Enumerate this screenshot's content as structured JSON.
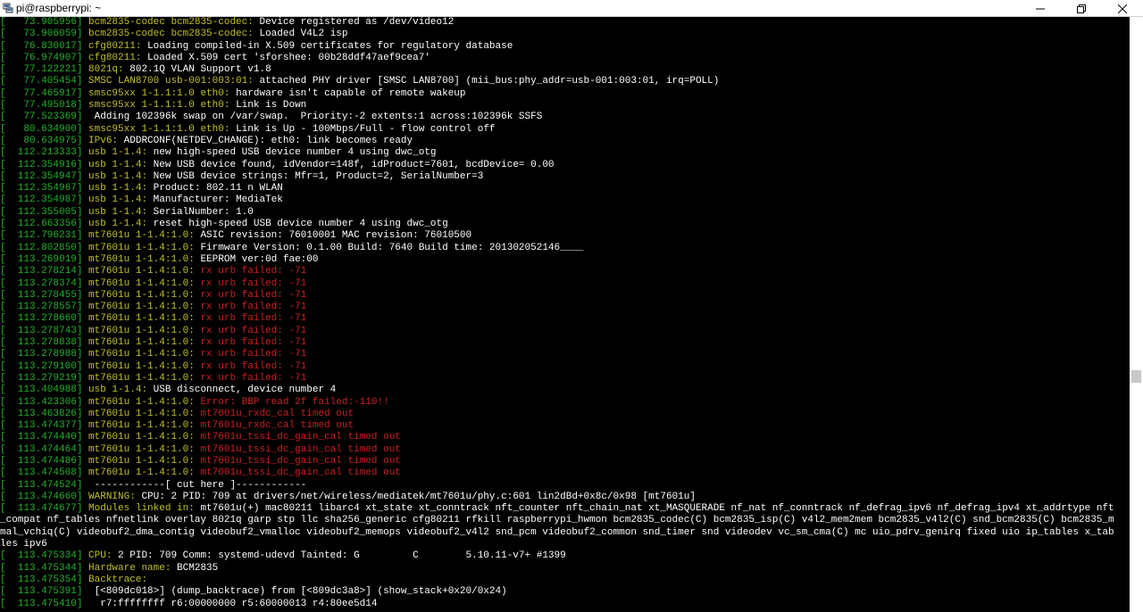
{
  "window": {
    "title": "pi@raspberrypi: ~",
    "minimize_glyph": "—",
    "maximize_glyph": "❐",
    "close_glyph": "✕"
  },
  "colors": {
    "background": "#000000",
    "text": "#ffffff",
    "timestamp": "#22b22a",
    "subsystem": "#c0c02a",
    "error": "#cc1f1f"
  },
  "lines": [
    {
      "ts": "[   73.905956]",
      "sub": "bcm2835-codec bcm2835-codec:",
      "msg": " Device registered as /dev/video12"
    },
    {
      "ts": "[   73.906059]",
      "sub": "bcm2835-codec bcm2835-codec:",
      "msg": " Loaded V4L2 isp"
    },
    {
      "ts": "[   76.830017]",
      "sub": "cfg80211:",
      "msg": " Loading compiled-in X.509 certificates for regulatory database"
    },
    {
      "ts": "[   76.974907]",
      "sub": "cfg80211:",
      "msg": " Loaded X.509 cert 'sforshee: 00b28ddf47aef9cea7'"
    },
    {
      "ts": "[   77.122221]",
      "sub": "8021q:",
      "msg": " 802.1Q VLAN Support v1.8"
    },
    {
      "ts": "[   77.405454]",
      "sub": "SMSC LAN8700 usb-001:003:01:",
      "msg": " attached PHY driver [SMSC LAN8700] (mii_bus:phy_addr=usb-001:003:01, irq=POLL)"
    },
    {
      "ts": "[   77.465917]",
      "sub": "smsc95xx 1-1.1:1.0 eth0:",
      "msg": " hardware isn't capable of remote wakeup"
    },
    {
      "ts": "[   77.495018]",
      "sub": "smsc95xx 1-1.1:1.0 eth0:",
      "msg": " Link is Down"
    },
    {
      "ts": "[   77.523369]",
      "sub": "",
      "msg": " Adding 102396k swap on /var/swap.  Priority:-2 extents:1 across:102396k SSFS"
    },
    {
      "ts": "[   80.634900]",
      "sub": "smsc95xx 1-1.1:1.0 eth0:",
      "msg": " Link is Up - 100Mbps/Full - flow control off"
    },
    {
      "ts": "[   80.634975]",
      "sub": "IPv6:",
      "msg": " ADDRCONF(NETDEV_CHANGE): eth0: link becomes ready"
    },
    {
      "ts": "[  112.213333]",
      "sub": "usb 1-1.4:",
      "msg": " new high-speed USB device number 4 using dwc_otg"
    },
    {
      "ts": "[  112.354916]",
      "sub": "usb 1-1.4:",
      "msg": " New USB device found, idVendor=148f, idProduct=7601, bcdDevice= 0.00"
    },
    {
      "ts": "[  112.354947]",
      "sub": "usb 1-1.4:",
      "msg": " New USB device strings: Mfr=1, Product=2, SerialNumber=3"
    },
    {
      "ts": "[  112.354967]",
      "sub": "usb 1-1.4:",
      "msg": " Product: 802.11 n WLAN"
    },
    {
      "ts": "[  112.354987]",
      "sub": "usb 1-1.4:",
      "msg": " Manufacturer: MediaTek"
    },
    {
      "ts": "[  112.355005]",
      "sub": "usb 1-1.4:",
      "msg": " SerialNumber: 1.0"
    },
    {
      "ts": "[  112.663356]",
      "sub": "usb 1-1.4:",
      "msg": " reset high-speed USB device number 4 using dwc_otg"
    },
    {
      "ts": "[  112.796231]",
      "sub": "mt7601u 1-1.4:1.0:",
      "msg": " ASIC revision: 76010001 MAC revision: 76010500"
    },
    {
      "ts": "[  112.802850]",
      "sub": "mt7601u 1-1.4:1.0:",
      "msg": " Firmware Version: 0.1.00 Build: 7640 Build time: 201302052146____"
    },
    {
      "ts": "[  113.269019]",
      "sub": "mt7601u 1-1.4:1.0:",
      "msg": " EEPROM ver:0d fae:00"
    },
    {
      "ts": "[  113.278214]",
      "sub": "mt7601u 1-1.4:1.0:",
      "err": " rx urb failed: -71"
    },
    {
      "ts": "[  113.278374]",
      "sub": "mt7601u 1-1.4:1.0:",
      "err": " rx urb failed: -71"
    },
    {
      "ts": "[  113.278455]",
      "sub": "mt7601u 1-1.4:1.0:",
      "err": " rx urb failed: -71"
    },
    {
      "ts": "[  113.278557]",
      "sub": "mt7601u 1-1.4:1.0:",
      "err": " rx urb failed: -71"
    },
    {
      "ts": "[  113.278660]",
      "sub": "mt7601u 1-1.4:1.0:",
      "err": " rx urb failed: -71"
    },
    {
      "ts": "[  113.278743]",
      "sub": "mt7601u 1-1.4:1.0:",
      "err": " rx urb failed: -71"
    },
    {
      "ts": "[  113.278838]",
      "sub": "mt7601u 1-1.4:1.0:",
      "err": " rx urb failed: -71"
    },
    {
      "ts": "[  113.278988]",
      "sub": "mt7601u 1-1.4:1.0:",
      "err": " rx urb failed: -71"
    },
    {
      "ts": "[  113.279100]",
      "sub": "mt7601u 1-1.4:1.0:",
      "err": " rx urb failed: -71"
    },
    {
      "ts": "[  113.279219]",
      "sub": "mt7601u 1-1.4:1.0:",
      "err": " rx urb failed: -71"
    },
    {
      "ts": "[  113.404988]",
      "sub": "usb 1-1.4:",
      "msg": " USB disconnect, device number 4"
    },
    {
      "ts": "[  113.423306]",
      "sub": "mt7601u 1-1.4:1.0:",
      "err": " Error: BBP read 2f failed:-110!!"
    },
    {
      "ts": "[  113.463826]",
      "sub": "mt7601u 1-1.4:1.0:",
      "err": " mt7601u_rxdc_cal timed out"
    },
    {
      "ts": "[  113.474377]",
      "sub": "mt7601u 1-1.4:1.0:",
      "err": " mt7601u_rxdc_cal timed out"
    },
    {
      "ts": "[  113.474440]",
      "sub": "mt7601u 1-1.4:1.0:",
      "err": " mt7601u_tssi_dc_gain_cal timed out"
    },
    {
      "ts": "[  113.474464]",
      "sub": "mt7601u 1-1.4:1.0:",
      "err": " mt7601u_tssi_dc_gain_cal timed out"
    },
    {
      "ts": "[  113.474486]",
      "sub": "mt7601u 1-1.4:1.0:",
      "err": " mt7601u_tssi_dc_gain_cal timed out"
    },
    {
      "ts": "[  113.474508]",
      "sub": "mt7601u 1-1.4:1.0:",
      "err": " mt7601u_tssi_dc_gain_cal timed out"
    },
    {
      "ts": "[  113.474524]",
      "sub": "",
      "msg": " ------------[ cut here ]------------"
    },
    {
      "ts": "[  113.474660]",
      "sub": "WARNING:",
      "msg": " CPU: 2 PID: 709 at drivers/net/wireless/mediatek/mt7601u/phy.c:601 lin2dBd+0x8c/0x98 [mt7601u]"
    },
    {
      "ts": "[  113.474677]",
      "sub": "Modules linked in:",
      "msg": " mt7601u(+) mac80211 libarc4 xt_state xt_conntrack nft_counter nft_chain_nat xt_MASQUERADE nf_nat nf_conntrack nf_defrag_ipv6 nf_defrag_ipv4 xt_addrtype nft"
    },
    {
      "ts": "",
      "sub": "",
      "msg": "_compat nf_tables nfnetlink overlay 8021q garp stp llc sha256_generic cfg80211 rfkill raspberrypi_hwmon bcm2835_codec(C) bcm2835_isp(C) v4l2_mem2mem bcm2835_v4l2(C) snd_bcm2835(C) bcm2835_m"
    },
    {
      "ts": "",
      "sub": "",
      "msg": "mal_vchiq(C) videobuf2_dma_contig videobuf2_vmalloc videobuf2_memops videobuf2_v4l2 snd_pcm videobuf2_common snd_timer snd videodev vc_sm_cma(C) mc uio_pdrv_genirq fixed uio ip_tables x_tab"
    },
    {
      "ts": "",
      "sub": "",
      "msg": "les ipv6"
    },
    {
      "ts": "[  113.475334]",
      "sub": "CPU:",
      "msg": " 2 PID: 709 Comm: systemd-udevd Tainted: G         C        5.10.11-v7+ #1399"
    },
    {
      "ts": "[  113.475344]",
      "sub": "Hardware name:",
      "msg": " BCM2835"
    },
    {
      "ts": "[  113.475354]",
      "sub": "Backtrace:",
      "msg": ""
    },
    {
      "ts": "[  113.475391]",
      "sub": "",
      "msg": " [<809dc018>] (dump_backtrace) from [<809dc3a8>] (show_stack+0x20/0x24)"
    },
    {
      "ts": "[  113.475410]",
      "sub": "",
      "msg": "  r7:ffffffff r6:00000000 r5:60000013 r4:80ee5d14"
    }
  ]
}
